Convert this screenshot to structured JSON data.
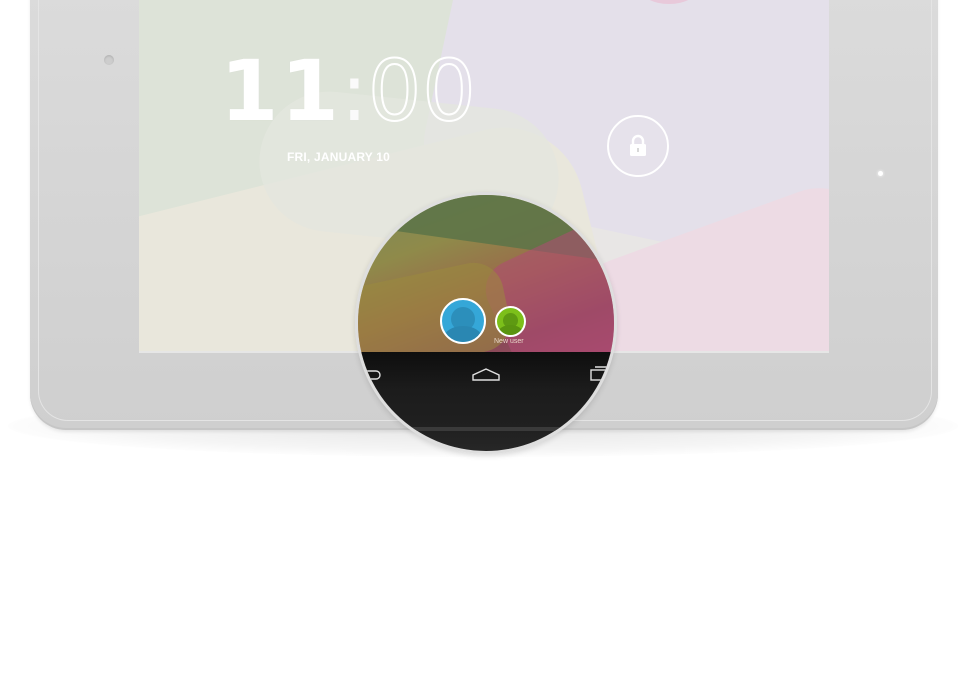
{
  "lockscreen": {
    "clock_hours": "11",
    "clock_separator": ":",
    "clock_minutes": "00",
    "date": "FRI, JANUARY 10"
  },
  "user_switcher": {
    "new_user_label": "New user"
  },
  "icons": {
    "lock": "lock-icon",
    "back": "back-icon",
    "home": "home-icon",
    "recent_apps": "recent-apps-icon",
    "user_avatar": "user-avatar-icon",
    "new_user_avatar": "new-user-avatar-icon"
  },
  "colors": {
    "user_avatar": "#35a7d8",
    "new_user_avatar": "#7cbf1a",
    "navbar": "#1a1a1a",
    "device_body": "#d6d6d6"
  }
}
